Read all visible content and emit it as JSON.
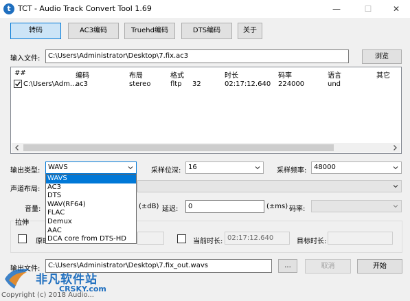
{
  "window": {
    "title": "TCT - Audio Track Convert Tool 1.69",
    "app_icon_glyph": "t"
  },
  "tabs": [
    {
      "label": "转码",
      "active": true
    },
    {
      "label": "AC3编码",
      "active": false
    },
    {
      "label": "Truehd编码",
      "active": false
    },
    {
      "label": "DTS编码",
      "active": false
    },
    {
      "label": "关于",
      "active": false
    }
  ],
  "input_file": {
    "label": "输入文件:",
    "value": "C:\\Users\\Administrator\\Desktop\\7.fix.ac3",
    "browse_label": "浏览"
  },
  "tracks": {
    "columns": [
      "##",
      "编码",
      "布局",
      "格式",
      "时长",
      "码率",
      "语言",
      "其它"
    ],
    "rows": [
      {
        "checked": true,
        "path": "C:\\Users\\Adm...",
        "codec": "ac3",
        "layout": "stereo",
        "format": "fltp",
        "bits": "32",
        "duration": "02:17:12.640",
        "bitrate": "224000",
        "language": "und"
      }
    ]
  },
  "output_type": {
    "label": "输出类型:",
    "selected": "WAVS",
    "options": [
      "WAVS",
      "AC3",
      "DTS",
      "WAV(RF64)",
      "FLAC",
      "Demux",
      "AAC",
      "DCA core from DTS-HD"
    ]
  },
  "bit_depth": {
    "label": "采样位深:",
    "selected": "16"
  },
  "sample_rate": {
    "label": "采样频率:",
    "selected": "48000"
  },
  "channel_layout": {
    "label": "声道布局:"
  },
  "volume": {
    "label": "音量:",
    "unit": "(±dB)"
  },
  "delay": {
    "label": "延迟:",
    "value": "0",
    "unit": "(±ms)"
  },
  "bitrate": {
    "label": "码率:"
  },
  "stretch": {
    "group_label": "拉伸",
    "original_duration_label": "原时长:",
    "current_duration_label": "当前时长:",
    "current_duration_value": "02:17:12.640",
    "target_duration_label": "目标时长:"
  },
  "output_file": {
    "label": "输出文件:",
    "value": "C:\\Users\\Administrator\\Desktop\\7.fix_out.wavs",
    "browse_label": "...",
    "cancel_label": "取消",
    "start_label": "开始"
  },
  "watermark": {
    "name": "非凡软件站",
    "domain": "CRSKY.com",
    "copyright": "Copyright (c) 2018 Audio..."
  },
  "colors": {
    "accent": "#0078d7",
    "tab_active_bg": "#cce4f7",
    "watermark_blue": "#1f6fbf"
  }
}
